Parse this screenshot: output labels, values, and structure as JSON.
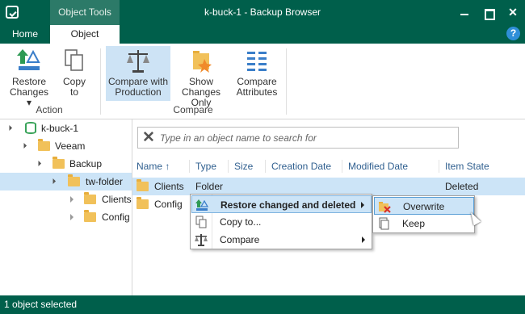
{
  "window": {
    "title": "k-buck-1 - Backup Browser",
    "contextual_tab_header": "Object Tools",
    "minimize_icon": "minimize-icon",
    "maximize_icon": "maximize-icon",
    "close_label": "✕"
  },
  "tabs": [
    {
      "label": "Home",
      "active": false
    },
    {
      "label": "Object",
      "active": true
    }
  ],
  "help_label": "?",
  "ribbon": {
    "groups": [
      {
        "label": "Action",
        "buttons": [
          {
            "label": "Restore\nChanges ▾",
            "icon": "restore-changes-icon",
            "active": false
          },
          {
            "label": "Copy\nto",
            "icon": "copy-icon",
            "active": false
          }
        ]
      },
      {
        "label": "Compare",
        "buttons": [
          {
            "label": "Compare with\nProduction",
            "icon": "scales-icon",
            "active": true
          },
          {
            "label": "Show\nChanges Only",
            "icon": "show-changes-icon",
            "active": false
          },
          {
            "label": "Compare\nAttributes",
            "icon": "compare-attributes-icon",
            "active": false
          }
        ]
      }
    ]
  },
  "tree": {
    "items": [
      {
        "label": "k-buck-1",
        "level": 0,
        "expanded": true,
        "icon": "database-icon",
        "selected": false
      },
      {
        "label": "Veeam",
        "level": 1,
        "expanded": true,
        "icon": "folder-icon",
        "selected": false
      },
      {
        "label": "Backup",
        "level": 2,
        "expanded": true,
        "icon": "folder-icon",
        "selected": false
      },
      {
        "label": "tw-folder",
        "level": 3,
        "expanded": true,
        "icon": "folder-icon",
        "selected": true
      },
      {
        "label": "Clients",
        "level": 4,
        "expanded": false,
        "icon": "folder-icon",
        "selected": false
      },
      {
        "label": "Config",
        "level": 4,
        "expanded": false,
        "icon": "folder-icon",
        "selected": false
      }
    ]
  },
  "search": {
    "placeholder": "Type in an object name to search for"
  },
  "grid": {
    "columns": [
      "Name",
      "Type",
      "Size",
      "Creation Date",
      "Modified Date",
      "Item State"
    ],
    "sort_indicator": "↑",
    "rows": [
      {
        "name": "Clients",
        "type": "Folder",
        "size": "",
        "creation_date": "",
        "modified_date": "",
        "item_state": "Deleted",
        "selected": true
      },
      {
        "name": "Config",
        "type": "",
        "size": "",
        "creation_date": "",
        "modified_date": "",
        "item_state": "",
        "selected": false
      }
    ]
  },
  "context_menu": {
    "items": [
      {
        "label": "Restore changed and deleted",
        "icon": "restore-changes-icon",
        "has_submenu": true,
        "highlighted": true,
        "bold": true
      },
      {
        "label": "Copy to...",
        "icon": "copy-icon",
        "has_submenu": false,
        "highlighted": false,
        "bold": false
      },
      {
        "label": "Compare",
        "icon": "scales-icon",
        "has_submenu": true,
        "highlighted": false,
        "bold": false
      }
    ]
  },
  "submenu": {
    "items": [
      {
        "label": "Overwrite",
        "icon": "overwrite-icon",
        "highlighted": true
      },
      {
        "label": "Keep",
        "icon": "keep-icon",
        "highlighted": false
      }
    ]
  },
  "status": {
    "text": "1 object selected"
  },
  "colors": {
    "brand": "#005f4b",
    "selection": "#cce4f7",
    "header_text": "#2f5f8f"
  }
}
